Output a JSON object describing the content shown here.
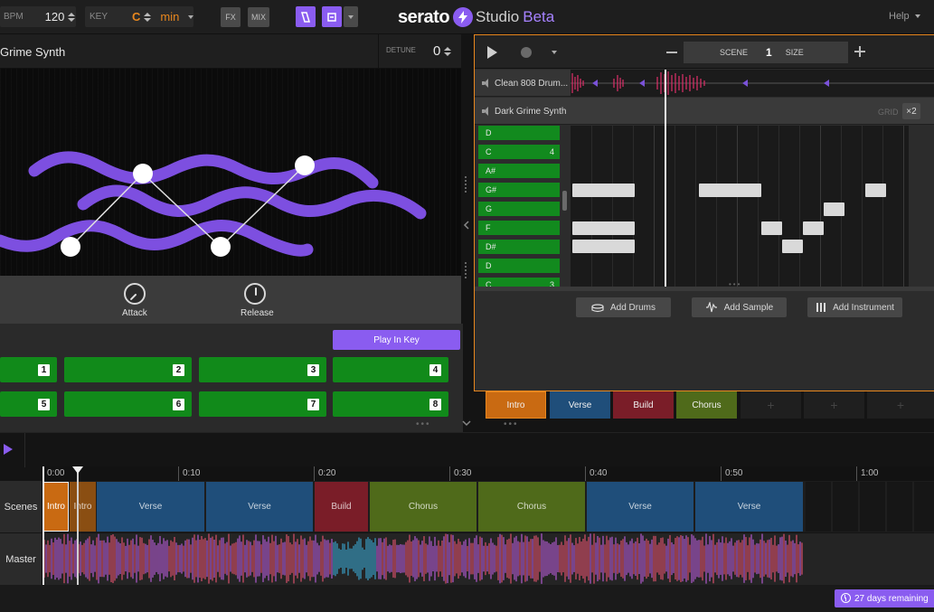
{
  "topbar": {
    "bpm_label": "BPM",
    "bpm_value": "120",
    "key_label": "KEY",
    "key_value": "C",
    "scale_value": "min",
    "fx_label": "FX",
    "mix_label": "MIX",
    "brand_logo": "serato",
    "brand_studio": "Studio",
    "brand_beta": "Beta",
    "help_label": "Help"
  },
  "instrument": {
    "name": "Grime Synth",
    "detune_label": "DETUNE",
    "detune_value": "0",
    "knobs": [
      {
        "label": "Attack"
      },
      {
        "label": "Release"
      }
    ],
    "play_in_key_label": "Play In Key",
    "pads": [
      "1",
      "2",
      "3",
      "4",
      "5",
      "6",
      "7",
      "8"
    ]
  },
  "deck": {
    "scene_label": "SCENE",
    "scene_value": "1",
    "size_label": "SIZE",
    "tracks": [
      {
        "name": "Clean 808 Drum..."
      },
      {
        "name": "Dark Grime Synth"
      }
    ],
    "grid_label": "GRID",
    "grid_value": "×2",
    "piano_keys": [
      {
        "note": "D",
        "octave": ""
      },
      {
        "note": "C",
        "octave": "4"
      },
      {
        "note": "A#",
        "octave": ""
      },
      {
        "note": "G#",
        "octave": ""
      },
      {
        "note": "G",
        "octave": ""
      },
      {
        "note": "F",
        "octave": ""
      },
      {
        "note": "D#",
        "octave": ""
      },
      {
        "note": "D",
        "octave": ""
      },
      {
        "note": "C",
        "octave": "3"
      }
    ],
    "add_buttons": [
      {
        "label": "Add Drums",
        "icon": "drum-kit-icon"
      },
      {
        "label": "Add Sample",
        "icon": "waveform-icon"
      },
      {
        "label": "Add Instrument",
        "icon": "piano-keys-icon"
      }
    ],
    "scene_tabs": [
      {
        "label": "Intro",
        "color": "#c96a12"
      },
      {
        "label": "Verse",
        "color": "#1f4e7a"
      },
      {
        "label": "Build",
        "color": "#7a1d28"
      },
      {
        "label": "Chorus",
        "color": "#4f6a1a"
      },
      {
        "label": "+",
        "color": "#1f1f1f"
      },
      {
        "label": "+",
        "color": "#1f1f1f"
      },
      {
        "label": "+",
        "color": "#1f1f1f"
      }
    ]
  },
  "arrangement": {
    "time_ticks": [
      "0:00",
      "0:10",
      "0:20",
      "0:30",
      "0:40",
      "0:50",
      "1:00"
    ],
    "lanes": [
      {
        "label": "Scenes"
      },
      {
        "label": "Master"
      }
    ],
    "segments": [
      {
        "label": "Intro",
        "color": "#c96a12"
      },
      {
        "label": "Intro",
        "color": "#8a4e12"
      },
      {
        "label": "Verse",
        "color": "#1f4e7a"
      },
      {
        "label": "Verse",
        "color": "#1f4e7a"
      },
      {
        "label": "Build",
        "color": "#7a1d28"
      },
      {
        "label": "Chorus",
        "color": "#4f6a1a"
      },
      {
        "label": "Chorus",
        "color": "#4f6a1a"
      },
      {
        "label": "Verse",
        "color": "#1f4e7a"
      },
      {
        "label": "Verse",
        "color": "#1f4e7a"
      }
    ]
  },
  "footer": {
    "trial_label": "27 days remaining"
  },
  "colors": {
    "accent_purple": "#8a5cf0",
    "accent_orange": "#e8871e",
    "pad_green": "#118a1a"
  }
}
